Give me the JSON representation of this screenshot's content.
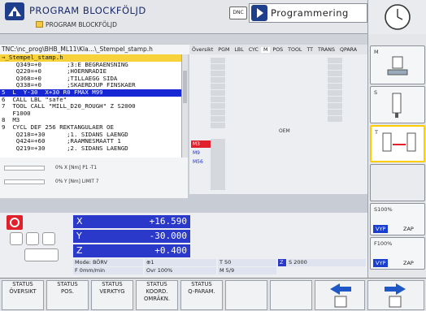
{
  "header": {
    "title": "PROGRAM BLOCKFÖLJD",
    "subtitle": "PROGRAM BLOCKFÖLJD",
    "dnc": "DNC",
    "mode_label": "Programmering"
  },
  "editor": {
    "path": "TNC:\\nc_prog\\BHB_ML11\\Kla…\\_Stempel_stamp.h",
    "lines": [
      {
        "text": "→_Stempel_stamp.h",
        "kind": "first"
      },
      {
        "text": "    Q349=+0       ;3:E BEGRAENSNING"
      },
      {
        "text": "    Q220=+0       ;HOERNRADIE"
      },
      {
        "text": "    Q368=+0       ;TILLAEGG SIDA"
      },
      {
        "text": "    Q338=+0       ;SKAERDJUP FINSKAER"
      },
      {
        "text": "5  L  Y-30  X+30 R0 FMAX M99",
        "kind": "hl"
      },
      {
        "text": "6  CALL LBL \"safe\""
      },
      {
        "text": "7  TOOL CALL \"MILL_D20_ROUGH\" Z S2000"
      },
      {
        "text": "   F1000"
      },
      {
        "text": "8  M3"
      },
      {
        "text": "9  CYCL DEF 256 REKTANGULAER OE"
      },
      {
        "text": "    Q218=+30      ;1. SIDANS LAENGD"
      },
      {
        "text": "    Q424=+60      ;RAAMNESMAATT 1"
      },
      {
        "text": "    Q219=+30      ;2. SIDANS LAENGD"
      }
    ]
  },
  "bars": {
    "row1": "0% X [Nm]  P1 -T1",
    "row2": "0% Y [Nm]  LIMIT 7"
  },
  "tabs": [
    "Översikt",
    "PGM",
    "LBL",
    "CYC",
    "M",
    "POS",
    "TOOL",
    "TT",
    "TRANS",
    "QPARA"
  ],
  "status": {
    "oem": "OEM",
    "m_codes": [
      "M3",
      "M9",
      "M56"
    ]
  },
  "dro": {
    "axes": [
      {
        "name": "X",
        "value": "+16.590"
      },
      {
        "name": "Y",
        "value": "-30.000"
      },
      {
        "name": "Z",
        "value": "+0.400"
      }
    ],
    "mode": "Mode: BÖRV",
    "tool_t": "T 50",
    "spindle_axis": "Z",
    "spindle": "S 2000",
    "feed": "F  0mm/min",
    "override": "Ovr 100%",
    "m_func": "M 5/9",
    "tool_num": "1"
  },
  "side": {
    "btn1": "M",
    "btn2": "S",
    "btn3": "T",
    "s_override": "S100%",
    "f_override": "F100%",
    "vyp": "VYP",
    "zap": "ZAP"
  },
  "softkeys": [
    {
      "l1": "STATUS",
      "l2": "ÖVERSIKT",
      "l3": ""
    },
    {
      "l1": "STATUS",
      "l2": "POS.",
      "l3": ""
    },
    {
      "l1": "STATUS",
      "l2": "VERKTYG",
      "l3": ""
    },
    {
      "l1": "STATUS",
      "l2": "KOORD.",
      "l3": "OMRÄKN."
    },
    {
      "l1": "STATUS",
      "l2": "Q-PARAM.",
      "l3": ""
    }
  ]
}
